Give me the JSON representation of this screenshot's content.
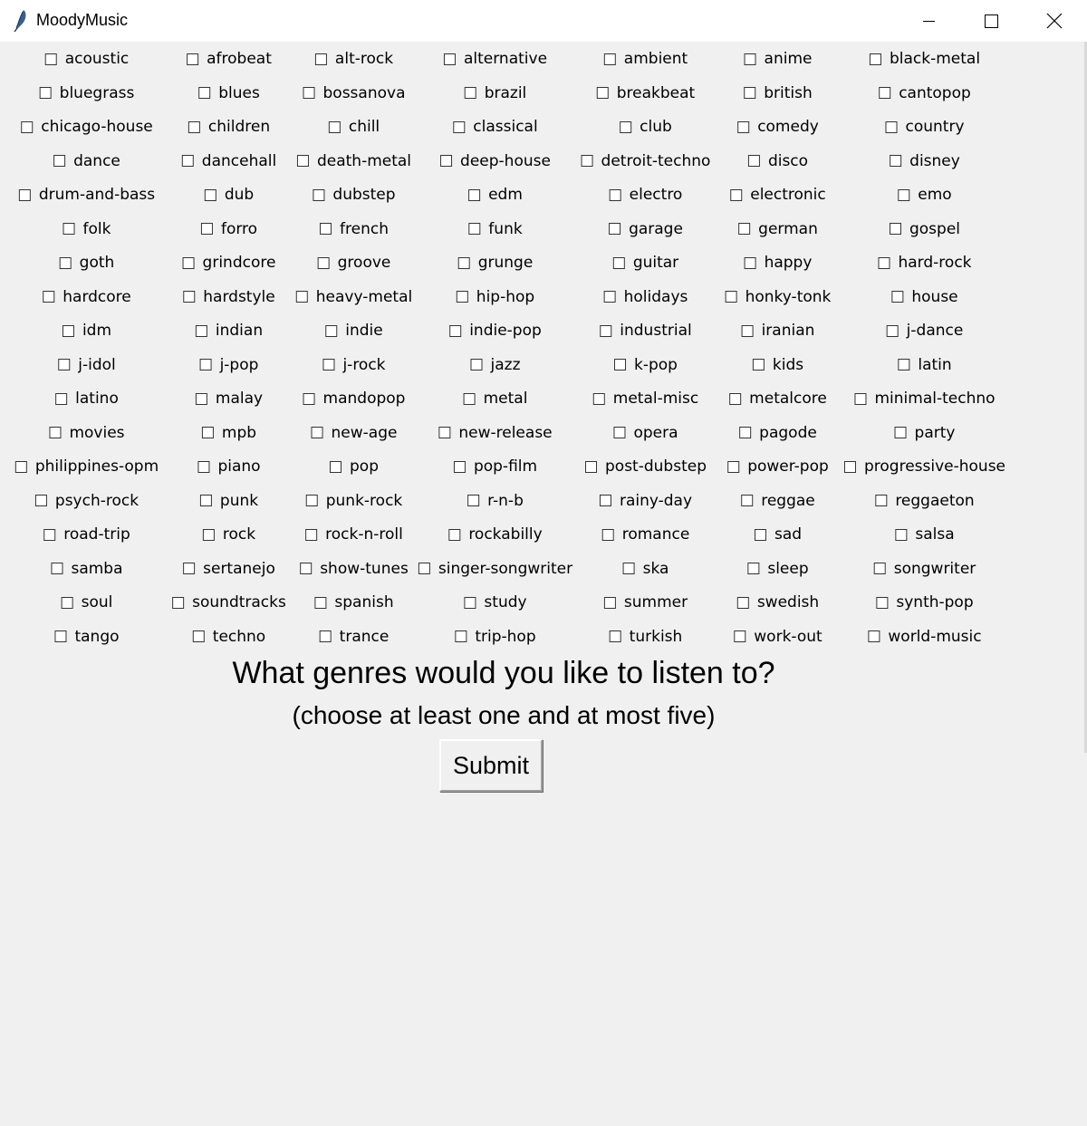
{
  "window": {
    "title": "MoodyMusic",
    "app_icon": "feather-icon",
    "controls": [
      "minimize-icon",
      "maximize-icon",
      "close-icon"
    ]
  },
  "genres": [
    "acoustic",
    "afrobeat",
    "alt-rock",
    "alternative",
    "ambient",
    "anime",
    "black-metal",
    "bluegrass",
    "blues",
    "bossanova",
    "brazil",
    "breakbeat",
    "british",
    "cantopop",
    "chicago-house",
    "children",
    "chill",
    "classical",
    "club",
    "comedy",
    "country",
    "dance",
    "dancehall",
    "death-metal",
    "deep-house",
    "detroit-techno",
    "disco",
    "disney",
    "drum-and-bass",
    "dub",
    "dubstep",
    "edm",
    "electro",
    "electronic",
    "emo",
    "folk",
    "forro",
    "french",
    "funk",
    "garage",
    "german",
    "gospel",
    "goth",
    "grindcore",
    "groove",
    "grunge",
    "guitar",
    "happy",
    "hard-rock",
    "hardcore",
    "hardstyle",
    "heavy-metal",
    "hip-hop",
    "holidays",
    "honky-tonk",
    "house",
    "idm",
    "indian",
    "indie",
    "indie-pop",
    "industrial",
    "iranian",
    "j-dance",
    "j-idol",
    "j-pop",
    "j-rock",
    "jazz",
    "k-pop",
    "kids",
    "latin",
    "latino",
    "malay",
    "mandopop",
    "metal",
    "metal-misc",
    "metalcore",
    "minimal-techno",
    "movies",
    "mpb",
    "new-age",
    "new-release",
    "opera",
    "pagode",
    "party",
    "philippines-opm",
    "piano",
    "pop",
    "pop-film",
    "post-dubstep",
    "power-pop",
    "progressive-house",
    "psych-rock",
    "punk",
    "punk-rock",
    "r-n-b",
    "rainy-day",
    "reggae",
    "reggaeton",
    "road-trip",
    "rock",
    "rock-n-roll",
    "rockabilly",
    "romance",
    "sad",
    "salsa",
    "samba",
    "sertanejo",
    "show-tunes",
    "singer-songwriter",
    "ska",
    "sleep",
    "songwriter",
    "soul",
    "soundtracks",
    "spanish",
    "study",
    "summer",
    "swedish",
    "synth-pop",
    "tango",
    "techno",
    "trance",
    "trip-hop",
    "turkish",
    "work-out",
    "world-music"
  ],
  "checked": [],
  "prompt": {
    "question": "What genres would you like to listen to?",
    "hint": "(choose at least one and at most five)"
  },
  "submit_label": "Submit"
}
